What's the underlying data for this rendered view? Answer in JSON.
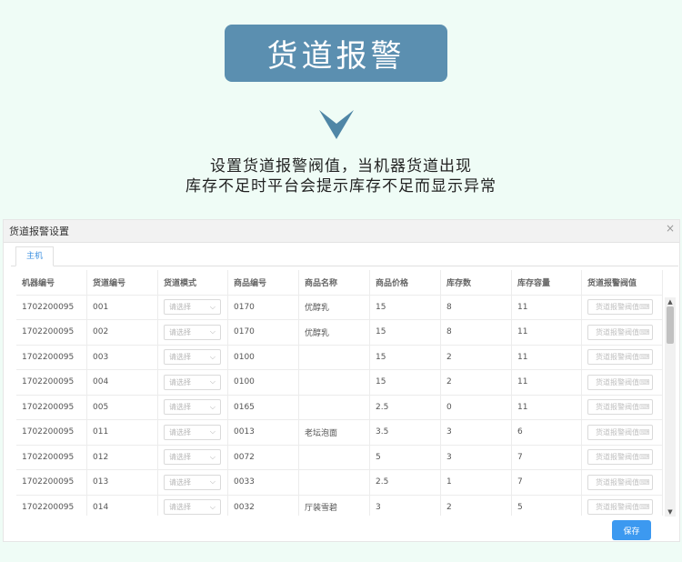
{
  "banner": {
    "title": "货道报警"
  },
  "description": {
    "line1": "设置货道报警阀值，当机器货道出现",
    "line2": "库存不足时平台会提示库存不足而显示异常"
  },
  "dialog": {
    "title": "货道报警设置",
    "close_icon": "×",
    "tab_label": "主机",
    "save_label": "保存",
    "select_placeholder": "请选择",
    "threshold_placeholder": "货道报警阀值",
    "columns": [
      "机器编号",
      "货道编号",
      "货道模式",
      "商品编号",
      "商品名称",
      "商品价格",
      "库存数",
      "库存容量",
      "货道报警阀值"
    ],
    "rows": [
      {
        "machine": "1702200095",
        "slot": "001",
        "product_code": "0170",
        "product_name": "优醇乳",
        "price": "15",
        "stock": "8",
        "capacity": "11"
      },
      {
        "machine": "1702200095",
        "slot": "002",
        "product_code": "0170",
        "product_name": "优醇乳",
        "price": "15",
        "stock": "8",
        "capacity": "11"
      },
      {
        "machine": "1702200095",
        "slot": "003",
        "product_code": "0100",
        "product_name": "",
        "price": "15",
        "stock": "2",
        "capacity": "11"
      },
      {
        "machine": "1702200095",
        "slot": "004",
        "product_code": "0100",
        "product_name": "",
        "price": "15",
        "stock": "2",
        "capacity": "11"
      },
      {
        "machine": "1702200095",
        "slot": "005",
        "product_code": "0165",
        "product_name": "",
        "price": "2.5",
        "stock": "0",
        "capacity": "11"
      },
      {
        "machine": "1702200095",
        "slot": "011",
        "product_code": "0013",
        "product_name": "老坛泡面",
        "price": "3.5",
        "stock": "3",
        "capacity": "6"
      },
      {
        "machine": "1702200095",
        "slot": "012",
        "product_code": "0072",
        "product_name": "",
        "price": "5",
        "stock": "3",
        "capacity": "7"
      },
      {
        "machine": "1702200095",
        "slot": "013",
        "product_code": "0033",
        "product_name": "",
        "price": "2.5",
        "stock": "1",
        "capacity": "7"
      },
      {
        "machine": "1702200095",
        "slot": "014",
        "product_code": "0032",
        "product_name": "厅装雪碧",
        "price": "3",
        "stock": "2",
        "capacity": "5"
      }
    ]
  },
  "icons": {
    "chevron": "chevron-down-icon",
    "keyboard": "keyboard-icon",
    "scroll_up": "▲",
    "scroll_down": "▼"
  },
  "colors": {
    "banner": "#5b8fb0",
    "accent": "#3c99f0",
    "background": "#effcf6"
  }
}
